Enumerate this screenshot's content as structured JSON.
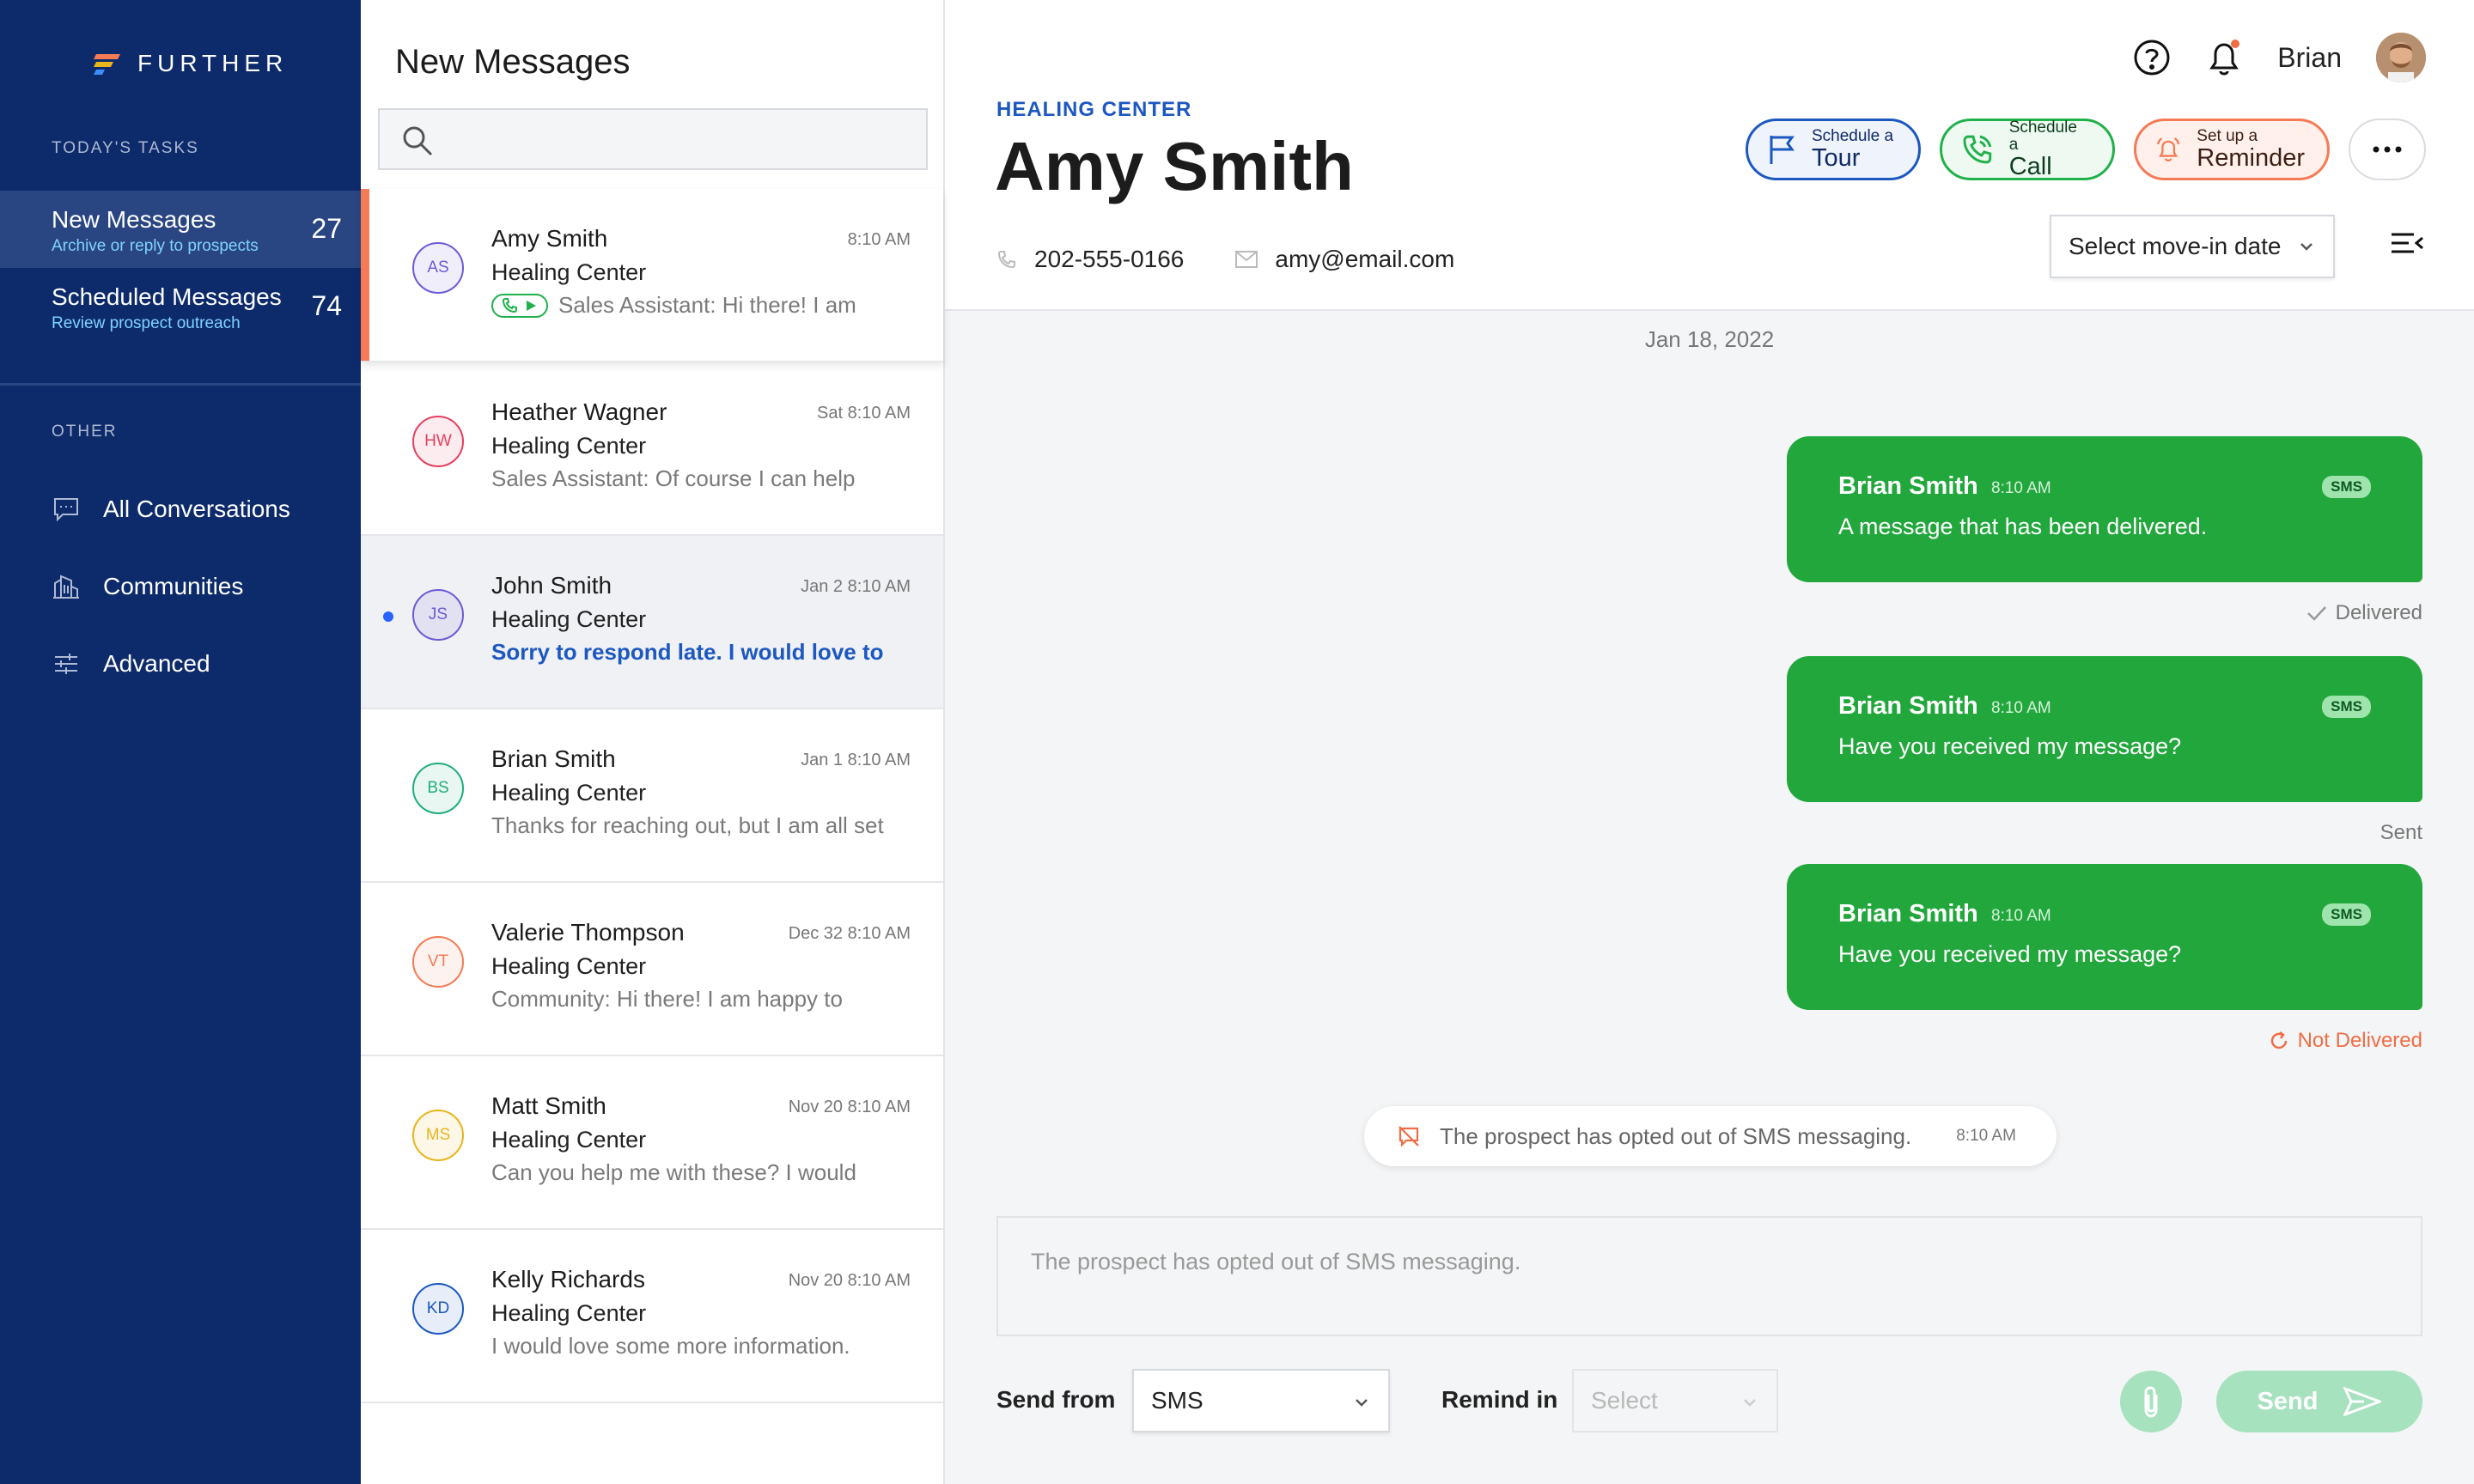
{
  "brand": {
    "name": "FURTHER"
  },
  "sidebar": {
    "tasks_label": "TODAY'S TASKS",
    "tasks": [
      {
        "title": "New Messages",
        "subtitle": "Archive or reply to prospects",
        "count": "27"
      },
      {
        "title": "Scheduled Messages",
        "subtitle": "Review prospect outreach",
        "count": "74"
      }
    ],
    "other_label": "OTHER",
    "nav": [
      {
        "label": "All Conversations",
        "icon": "chat-icon"
      },
      {
        "label": "Communities",
        "icon": "building-icon"
      },
      {
        "label": "Advanced",
        "icon": "sliders-icon"
      }
    ]
  },
  "list": {
    "title": "New Messages",
    "search_placeholder": "",
    "items": [
      {
        "initials": "AS",
        "name": "Amy Smith",
        "time": "8:10 AM",
        "community": "Healing Center",
        "preview": "Sales Assistant: Hi there! I am",
        "color": "#6b5bd6"
      },
      {
        "initials": "HW",
        "name": "Heather Wagner",
        "time": "Sat 8:10 AM",
        "community": "Healing Center",
        "preview": "Sales Assistant: Of course I can help",
        "color": "#e6405f"
      },
      {
        "initials": "JS",
        "name": "John Smith",
        "time": "Jan 2 8:10 AM",
        "community": "Healing Center",
        "preview": "Sorry to respond late. I would love to",
        "color": "#6b5bd6"
      },
      {
        "initials": "BS",
        "name": "Brian Smith",
        "time": "Jan 1 8:10 AM",
        "community": "Healing Center",
        "preview": "Thanks for reaching out, but I am all set",
        "color": "#1fae7a"
      },
      {
        "initials": "VT",
        "name": "Valerie Thompson",
        "time": "Dec 32 8:10 AM",
        "community": "Healing Center",
        "preview": "Community: Hi there! I am happy to",
        "color": "#f47b55"
      },
      {
        "initials": "MS",
        "name": "Matt Smith",
        "time": "Nov 20 8:10 AM",
        "community": "Healing Center",
        "preview": "Can you help me with these? I would",
        "color": "#e9b51c"
      },
      {
        "initials": "KD",
        "name": "Kelly Richards",
        "time": "Nov 20 8:10 AM",
        "community": "Healing Center",
        "preview": "I would love some more information.",
        "color": "#1c58c0"
      }
    ]
  },
  "header": {
    "user_name": "Brian",
    "community": "HEALING CENTER",
    "contact_name": "Amy Smith",
    "phone": "202-555-0166",
    "email": "amy@email.com",
    "actions": {
      "tour_small": "Schedule a",
      "tour_big": "Tour",
      "call_small": "Schedule a",
      "call_big": "Call",
      "remind_small": "Set up a",
      "remind_big": "Reminder"
    },
    "movein_label": "Select move-in date"
  },
  "conversation": {
    "date": "Jan 18, 2022",
    "messages": [
      {
        "sender": "Brian Smith",
        "time": "8:10 AM",
        "channel": "SMS",
        "text": "A message that has been delivered.",
        "status": "Delivered"
      },
      {
        "sender": "Brian Smith",
        "time": "8:10 AM",
        "channel": "SMS",
        "text": "Have you received my message?",
        "status": "Sent"
      },
      {
        "sender": "Brian Smith",
        "time": "8:10 AM",
        "channel": "SMS",
        "text": "Have you received my message?",
        "status": "Not Delivered"
      }
    ],
    "optout_notice": "The prospect has opted out of SMS messaging.",
    "optout_time": "8:10 AM"
  },
  "composer": {
    "placeholder": "The prospect has opted out of SMS messaging.",
    "send_from_label": "Send from",
    "send_from_value": "SMS",
    "remind_label": "Remind in",
    "remind_value": "Select",
    "send_label": "Send"
  },
  "colors": {
    "sidebar_bg": "#0d2b6b",
    "accent_blue": "#1c58c0",
    "bubble_green": "#22a73d",
    "accent_orange": "#f47b55"
  }
}
